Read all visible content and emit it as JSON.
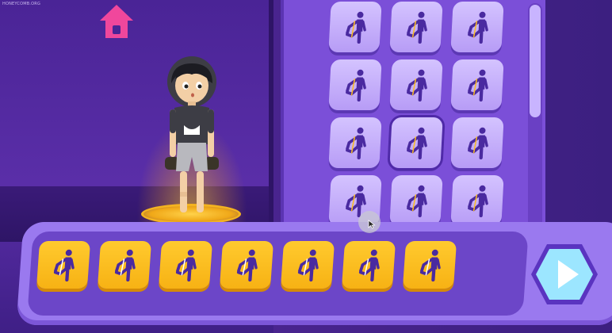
{
  "watermark": "HONEYCOMB.ORG",
  "colors": {
    "home_icon": "#f0479c",
    "library_card": "#c9b6fb",
    "sequence_card": "#fbbd1f",
    "play_button": "#9ce6ff",
    "move_figure": "#4a2aa0"
  },
  "home": {
    "icon": "home-icon"
  },
  "library": {
    "rows": 4,
    "columns": 3,
    "selected_index": 7,
    "card_icon": "kick-move-icon"
  },
  "sequence": {
    "count": 7,
    "card_icon": "kick-move-icon"
  },
  "play": {
    "icon": "play-icon"
  }
}
